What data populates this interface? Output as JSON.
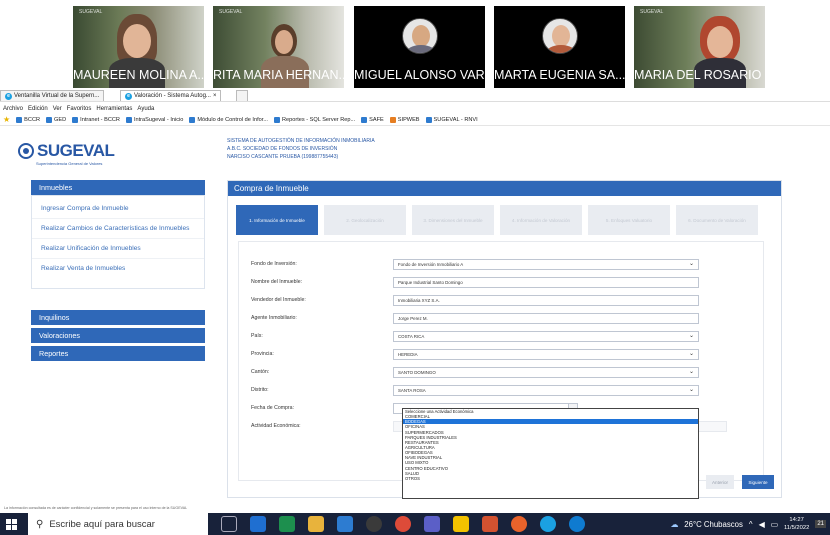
{
  "video": {
    "participants": [
      {
        "name": "MAUREEN MOLINA A...",
        "tag": "SUGEVAL"
      },
      {
        "name": "RITA MARIA HERNAN...",
        "tag": "SUGEVAL"
      },
      {
        "name": "MIGUEL ALONSO VAR...",
        "tag": ""
      },
      {
        "name": "MARTA EUGENIA SA...",
        "tag": ""
      },
      {
        "name": "MARIA DEL ROSARIO ...",
        "tag": "SUGEVAL"
      }
    ]
  },
  "browser": {
    "tabs": [
      "Ventanilla Virtual de la Supern...",
      "Valoración - Sistema Autog..."
    ],
    "tab_close": "×",
    "menu": [
      "Archivo",
      "Edición",
      "Ver",
      "Favoritos",
      "Herramientas",
      "Ayuda"
    ],
    "favorites": [
      "BCCR",
      "GED",
      "Intranet - BCCR",
      "IntraSugeval - Inicio",
      "Módulo de Control de Infor...",
      "Reportes - SQL Server Rep...",
      "SAFE",
      "SIPWEB",
      "SUGEVAL - RNVI"
    ]
  },
  "header": {
    "brand": "SUGEVAL",
    "brand_sub": "Superintendencia General de Valores",
    "system": "SISTEMA DE AUTOGESTIÓN DE INFORMACIÓN INMOBILIARIA",
    "company": "A.B.C. SOCIEDAD DE FONDOS DE INVERSIÓN",
    "user": "NARCISO CASCANTE PRUEBA (199887755443)"
  },
  "sidebar": {
    "inmuebles": "Inmuebles",
    "items": [
      "Ingresar Compra de Inmueble",
      "Realizar Cambios de Características de Inmuebles",
      "Realizar Unificación de Inmuebles",
      "Realizar Venta de Inmuebles"
    ],
    "inquilinos": "Inquilinos",
    "valoraciones": "Valoraciones",
    "reportes": "Reportes"
  },
  "main": {
    "title": "Compra de Inmueble",
    "steps": [
      "1. Información de Inmueble",
      "2. Geolocalización",
      "3. Dimensiones del Inmueble",
      "4. Información de Valoración",
      "5. Enfoques Valuatorio",
      "6. Documento de Valoración"
    ],
    "fields": [
      {
        "label": "Fondo de Inversión:",
        "value": "Fondo de Inversión Inmobiliario A",
        "select": true
      },
      {
        "label": "Nombre del Inmueble:",
        "value": "Parque Industrial Santo Domingo",
        "select": false
      },
      {
        "label": "Vendedor del Inmueble:",
        "value": "Inmobiliaria XYZ S.A.",
        "select": false
      },
      {
        "label": "Agente Inmobiliario:",
        "value": "Jorge Perez M.",
        "select": false
      },
      {
        "label": "País:",
        "value": "COSTA RICA",
        "select": true
      },
      {
        "label": "Provincia:",
        "value": "HEREDIA",
        "select": true
      },
      {
        "label": "Cantón:",
        "value": "SANTO DOMINGO",
        "select": true
      },
      {
        "label": "Distrito:",
        "value": "SANTA ROSA",
        "select": true
      }
    ],
    "fecha_label": "Fecha de Compra:",
    "actividad_label": "Actividad Económica:",
    "dropdown": [
      "Seleccione una Actividad Económica",
      "COMERCIAL",
      "BODEGAS",
      "OFICINAS",
      "SUPERMERCADOS",
      "PARQUES INDUSTRIALES",
      "RESTAURANTES",
      "AGRICULTURA",
      "OFIBODEGAS",
      "NAVE INDUSTRIAL",
      "USO MIXTO",
      "CENTRO EDUCATIVO",
      "SALUD",
      "OTROS"
    ],
    "dropdown_selected": 2,
    "anterior": "Anterior",
    "siguiente": "Siguiente"
  },
  "footer": "La información consultada es de carácter confidencial y solamente se presenta para el uso interno de la SUGEVAL",
  "taskbar": {
    "search": "Escribe aquí para buscar",
    "weather": "26°C Chubascos",
    "time": "14:27",
    "date": "11/5/2022",
    "notif": "21"
  }
}
